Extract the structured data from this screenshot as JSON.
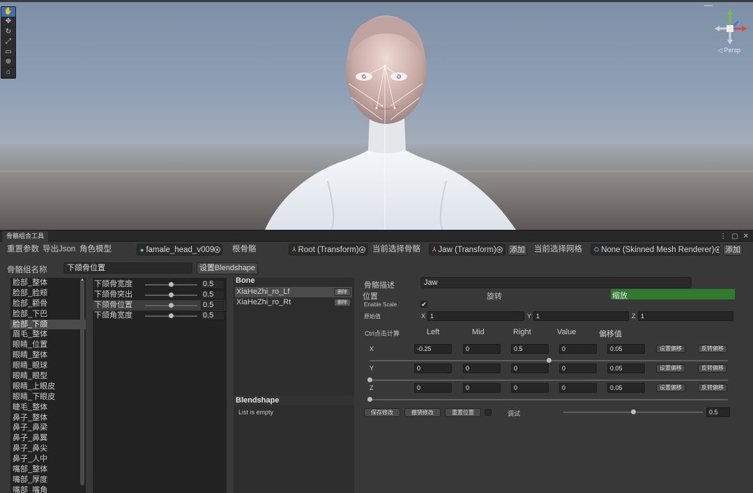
{
  "scene": {
    "persp_label": "◁ Persp",
    "tools": [
      "hand-icon",
      "move-icon",
      "rotate-icon",
      "scale-icon",
      "rect-icon",
      "transform-icon",
      "custom-tool-icon"
    ]
  },
  "window": {
    "tab_title": "骨骼组合工具"
  },
  "toolbar": {
    "reset_params": "重置参数",
    "export_json": "导出Json",
    "character_model_label": "角色模型",
    "character_model_value": "famale_head_v009",
    "root_bone_label": "根骨骼",
    "root_bone_value": "Root (Transform)",
    "current_bone_label": "当前选择骨骼",
    "current_bone_value": "Jaw (Transform)",
    "add_label": "添加",
    "current_mesh_label": "当前选择网格",
    "current_mesh_value": "None (Skinned Mesh Renderer)",
    "add_label_2": "添加"
  },
  "group": {
    "name_label": "骨骼组名称",
    "name_value": "下颌骨位置",
    "set_blendshape": "设置Blendshape"
  },
  "group_list": {
    "items": [
      "脸部_整体",
      "脸部_脸颊",
      "脸部_颧骨",
      "脸部_下巴",
      "脸部_下颌",
      "眉毛_整体",
      "眼睛_位置",
      "眼睛_整体",
      "眼睛_眼球",
      "眼睛_眼型",
      "眼睛_上眼皮",
      "眼睛_下眼皮",
      "睫毛_整体",
      "鼻子_整体",
      "鼻子_鼻梁",
      "鼻子_鼻翼",
      "鼻子_鼻尖",
      "鼻子_人中",
      "嘴部_整体",
      "嘴部_厚度",
      "嘴部_嘴角"
    ],
    "selected_index": 4
  },
  "params": [
    {
      "label": "下颌骨宽度",
      "value": "0.5",
      "level": 0.5
    },
    {
      "label": "下颌骨突出",
      "value": "0.5",
      "level": 0.5
    },
    {
      "label": "下颌骨位置",
      "value": "0.5",
      "level": 0.5
    },
    {
      "label": "下颌角宽度",
      "value": "0.5",
      "level": 0.5
    }
  ],
  "bone_panel": {
    "title": "Bone",
    "bones": [
      "XiaHeZhi_ro_Lf",
      "XiaHeZhi_ro_Rt"
    ],
    "delete_label": "删除",
    "blendshape_title": "Blendshape",
    "empty_text": "List is empty"
  },
  "detail": {
    "desc_label": "骨骼描述",
    "desc_value": "Jaw",
    "tab_position": "位置",
    "tab_rotation": "旋转",
    "tab_scale": "缩放",
    "enable_scale_label": "Enable Scale",
    "enable_scale_checked": "✔",
    "original_label": "原始值",
    "orig_x_label": "X",
    "orig_x": "1",
    "orig_y_label": "Y",
    "orig_y": "1",
    "orig_z_label": "Z",
    "orig_z": "1",
    "ctrl_hint": "Ctrl点击计算",
    "col_left": "Left",
    "col_mid": "Mid",
    "col_right": "Right",
    "col_value": "Value",
    "col_offset": "偏移值",
    "rows": [
      {
        "axis": "X",
        "left": "-0.25",
        "mid": "0",
        "right": "0.5",
        "value": "0",
        "offset": "0.05",
        "slider": 0.5
      },
      {
        "axis": "Y",
        "left": "0",
        "mid": "0",
        "right": "0",
        "value": "0",
        "offset": "0.05",
        "slider": 0.0
      },
      {
        "axis": "Z",
        "left": "0",
        "mid": "0",
        "right": "0",
        "value": "0",
        "offset": "0.05",
        "slider": 0.0
      }
    ],
    "set_offset": "设置偏移",
    "reverse_offset": "反转偏移",
    "save_changes": "保存修改",
    "undo_changes": "撤销修改",
    "reset_position": "重置位置",
    "debug_label": "调试",
    "debug_value": "0.5",
    "debug_level": 0.5
  },
  "colors": {
    "scale_tab_active": "#2f7a2f",
    "accent_blue": "#3a6fb0"
  }
}
